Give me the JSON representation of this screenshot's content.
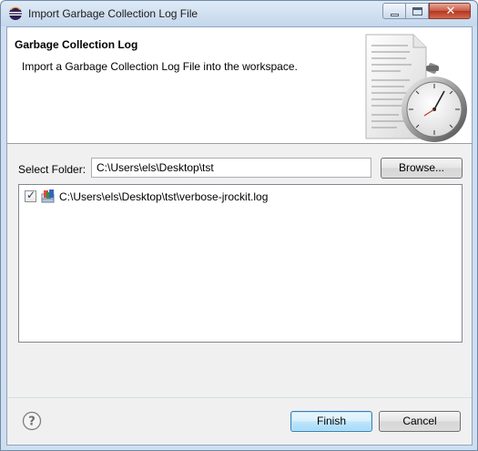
{
  "window": {
    "title": "Import Garbage Collection Log File",
    "close_symbol": "✕"
  },
  "banner": {
    "title": "Garbage Collection Log",
    "description": "Import a Garbage Collection Log File into the workspace.",
    "image_icon": "stopwatch-over-document"
  },
  "folder": {
    "label": "Select Folder:",
    "value": "C:\\Users\\els\\Desktop\\tst",
    "browse_label": "Browse..."
  },
  "files": [
    {
      "checked": true,
      "name": "C:\\Users\\els\\Desktop\\tst\\verbose-jrockit.log",
      "icon": "log-file-icon"
    }
  ],
  "footer": {
    "help_icon": "help-icon",
    "finish_label": "Finish",
    "cancel_label": "Cancel"
  },
  "colors": {
    "window_frame": "#cfdff0",
    "dialog_bg": "#f0f0f0",
    "default_button": "#3c7fb1"
  }
}
